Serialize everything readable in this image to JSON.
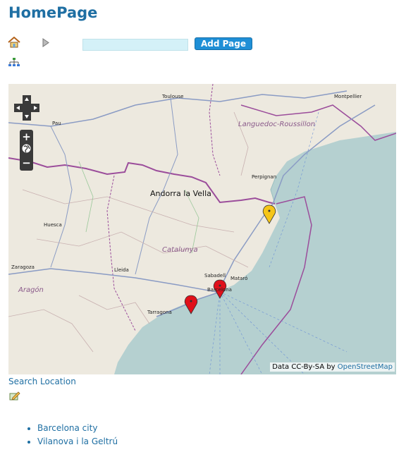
{
  "page": {
    "title": "HomePage"
  },
  "toolbar": {
    "add_page_label": "Add Page",
    "input_value": ""
  },
  "icons": {
    "home": "home-icon",
    "play": "play-arrow-icon",
    "sitemap": "sitemap-icon",
    "edit": "edit-pencil-icon"
  },
  "map": {
    "labels": {
      "toulouse": "Toulouse",
      "montpellier": "Montpellier",
      "pau": "Pau",
      "languedoc": "Languedoc-Roussillon",
      "perpignan": "Perpignan",
      "andorra": "Andorra la Vella",
      "huesca": "Huesca",
      "catalunya": "Catalunya",
      "zaragoza": "Zaragoza",
      "lleida": "Lleida",
      "aragon": "Aragón",
      "sabadell": "Sabadell",
      "mataro": "Mataró",
      "barcelona": "Barcelona",
      "tarragona": "Tarragona"
    },
    "zoom_in": "+",
    "zoom_out": "−",
    "attribution_prefix": "Data CC-By-SA by",
    "attribution_link": "OpenStreetMap",
    "colors": {
      "sea": "#b5d0d0",
      "land": "#ede9df",
      "border": "#9b4d9b",
      "marker_red": "#e0101a",
      "marker_yellow": "#f5c518"
    }
  },
  "search_location_label": "Search Location",
  "locations": [
    "Barcelona city",
    "Vilanova i la Geltrú"
  ]
}
